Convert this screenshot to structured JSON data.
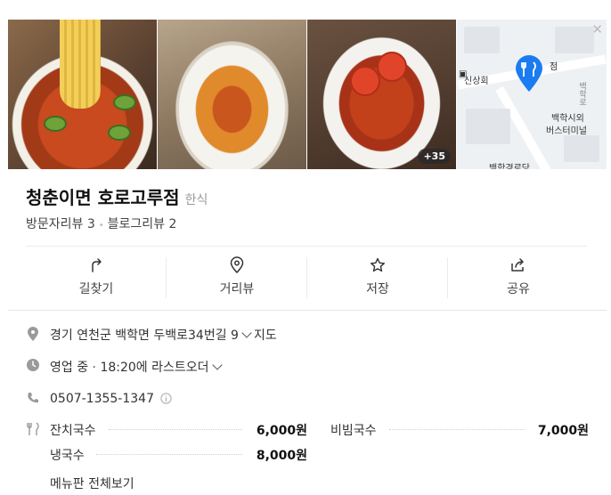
{
  "photos": {
    "more_count": "+35"
  },
  "map": {
    "labels": [
      "신상회",
      "점",
      "백학시외",
      "버스터미널",
      "백학로",
      "백학경로당"
    ]
  },
  "place": {
    "name": "청춘이면 호로고루점",
    "category": "한식",
    "visitor_reviews": "방문자리뷰 3",
    "blog_reviews": "블로그리뷰 2"
  },
  "actions": [
    {
      "label": "길찾기",
      "icon": "directions-icon"
    },
    {
      "label": "거리뷰",
      "icon": "location-pin-icon"
    },
    {
      "label": "저장",
      "icon": "star-icon"
    },
    {
      "label": "공유",
      "icon": "share-icon"
    }
  ],
  "info": {
    "address": "경기 연천군 백학면 두백로34번길 9",
    "map_link": "지도",
    "status": "영업 중",
    "status_detail": "18:20에 라스트오더",
    "phone": "0507-1355-1347"
  },
  "menu": {
    "items": [
      {
        "name": "잔치국수",
        "price": "6,000원"
      },
      {
        "name": "비빔국수",
        "price": "7,000원"
      },
      {
        "name": "냉국수",
        "price": "8,000원"
      }
    ],
    "view_all": "메뉴판 전체보기"
  },
  "colors": {
    "accent": "#1a54c9",
    "pin": "#1a7cf0"
  }
}
